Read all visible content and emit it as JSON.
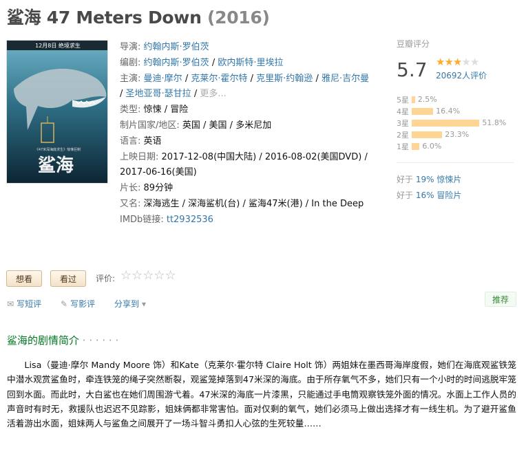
{
  "movie": {
    "title": "鲨海 47 Meters Down",
    "year": "(2016)",
    "poster": {
      "banner": "12月8日  绝境求生",
      "tagline": "《47米深海底求生》惊悚巨制",
      "title": "鲨海"
    },
    "info": {
      "director_label": "导演:",
      "director": "约翰内斯·罗伯茨",
      "writer_label": "编剧:",
      "writer_1": "约翰内斯·罗伯茨",
      "writer_2": "欧内斯特·里埃拉",
      "cast_label": "主演:",
      "cast": [
        "曼迪·摩尔",
        "克莱尔·霍尔特",
        "克里斯·约翰逊",
        "雅尼·吉尔曼",
        "圣地亚哥·瑟甘拉"
      ],
      "cast_more": "更多...",
      "genre_label": "类型:",
      "genre_1": "惊悚",
      "genre_2": "冒险",
      "country_label": "制片国家/地区:",
      "country": "英国 / 美国 / 多米尼加",
      "language_label": "语言:",
      "language": "英语",
      "release_label": "上映日期:",
      "release_1": "2017-12-08(中国大陆)",
      "release_2": "2016-08-02(美国DVD)",
      "release_3": "2017-06-16(美国)",
      "runtime_label": "片长:",
      "runtime": "89分钟",
      "aka_label": "又名:",
      "aka": "深海逃生 / 深海鲨机(台) / 鲨海47米(港) / In the Deep",
      "imdb_label": "IMDb链接:",
      "imdb": "tt2932536"
    }
  },
  "rating": {
    "label": "豆瓣评分",
    "score": "5.7",
    "stars_filled": 3,
    "stars_total": 5,
    "votes": "20692人评价",
    "breakdown": [
      {
        "label": "5星",
        "pct": "2.5%",
        "value": 2.5
      },
      {
        "label": "4星",
        "pct": "16.4%",
        "value": 16.4
      },
      {
        "label": "3星",
        "pct": "51.8%",
        "value": 51.8
      },
      {
        "label": "2星",
        "pct": "23.3%",
        "value": 23.3
      },
      {
        "label": "1星",
        "pct": "6.0%",
        "value": 6.0
      }
    ],
    "better_than": [
      {
        "prefix": "好于",
        "pct": "19%",
        "genre": "惊悚片"
      },
      {
        "prefix": "好于",
        "pct": "16%",
        "genre": "冒险片"
      }
    ]
  },
  "actions": {
    "want": "想看",
    "seen": "看过",
    "rate_label": "评价:",
    "rate_stars": "☆☆☆☆☆",
    "short_review": "写短评",
    "review": "写影评",
    "share": "分享到",
    "recommend": "推荐"
  },
  "synopsis": {
    "title": "鲨海的剧情简介",
    "dots": " · · · · · ·",
    "text": "Lisa（曼迪·摩尔 Mandy Moore 饰）和Kate（克莱尔·霍尔特 Claire Holt 饰）两姐妹在墨西哥海岸度假，她们在海底观鲨铁笼中潜水观赏鲨鱼时，牵连铁笼的绳子突然断裂，观鲨笼掉落到47米深的海底。由于所存氧气不多，她们只有一个小时的时间逃脱牢笼回到水面。而此时，大白鲨也在她们周围游弋着。47米深的海底一片漆黑，只能通过手电筒观察铁笼外面的情况。水面上工作人员的声音时有时无，救援队也迟迟不见踪影，姐妹俩都非常害怕。面对仅剩的氧气，她们必须马上做出选择才有一线生机。为了避开鲨鱼活着游出水面，姐妹两人与鲨鱼之间展开了一场斗智斗勇扣人心弦的生死较量……"
  },
  "colors": {
    "link": "#3377aa",
    "green": "#007722",
    "star": "#ffac2d",
    "bar": "#ffd596"
  }
}
